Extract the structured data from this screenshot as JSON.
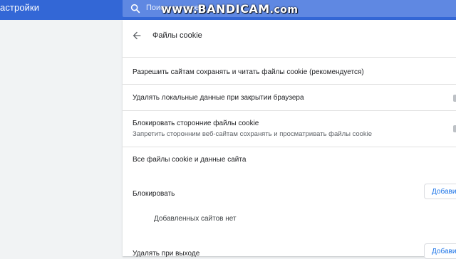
{
  "header": {
    "app_title": "астройки",
    "search_placeholder": "Поиск настроек",
    "watermark_main": "www.BANDICAM",
    "watermark_tail": ".com"
  },
  "page": {
    "title": "Файлы cookie"
  },
  "settings": {
    "allow_sites": "Разрешить сайтам сохранять и читать файлы cookie (рекомендуется)",
    "clear_on_exit": "Удалять локальные данные при закрытии браузера",
    "block_third_party": "Блокировать сторонние файлы cookie",
    "block_third_party_sub": "Запретить сторонним веб-сайтам сохранять и просматривать файлы cookie",
    "all_cookies": "Все файлы cookie и данные сайта"
  },
  "block_section": {
    "label": "Блокировать",
    "add_button": "Добавить",
    "empty": "Добавленных сайтов нет"
  },
  "clear_section": {
    "label": "Удалять при выходе",
    "add_button": "Добавить"
  },
  "colors": {
    "header_blue": "#3367d6",
    "accent": "#1a73e8",
    "background": "#f1f3f4"
  }
}
